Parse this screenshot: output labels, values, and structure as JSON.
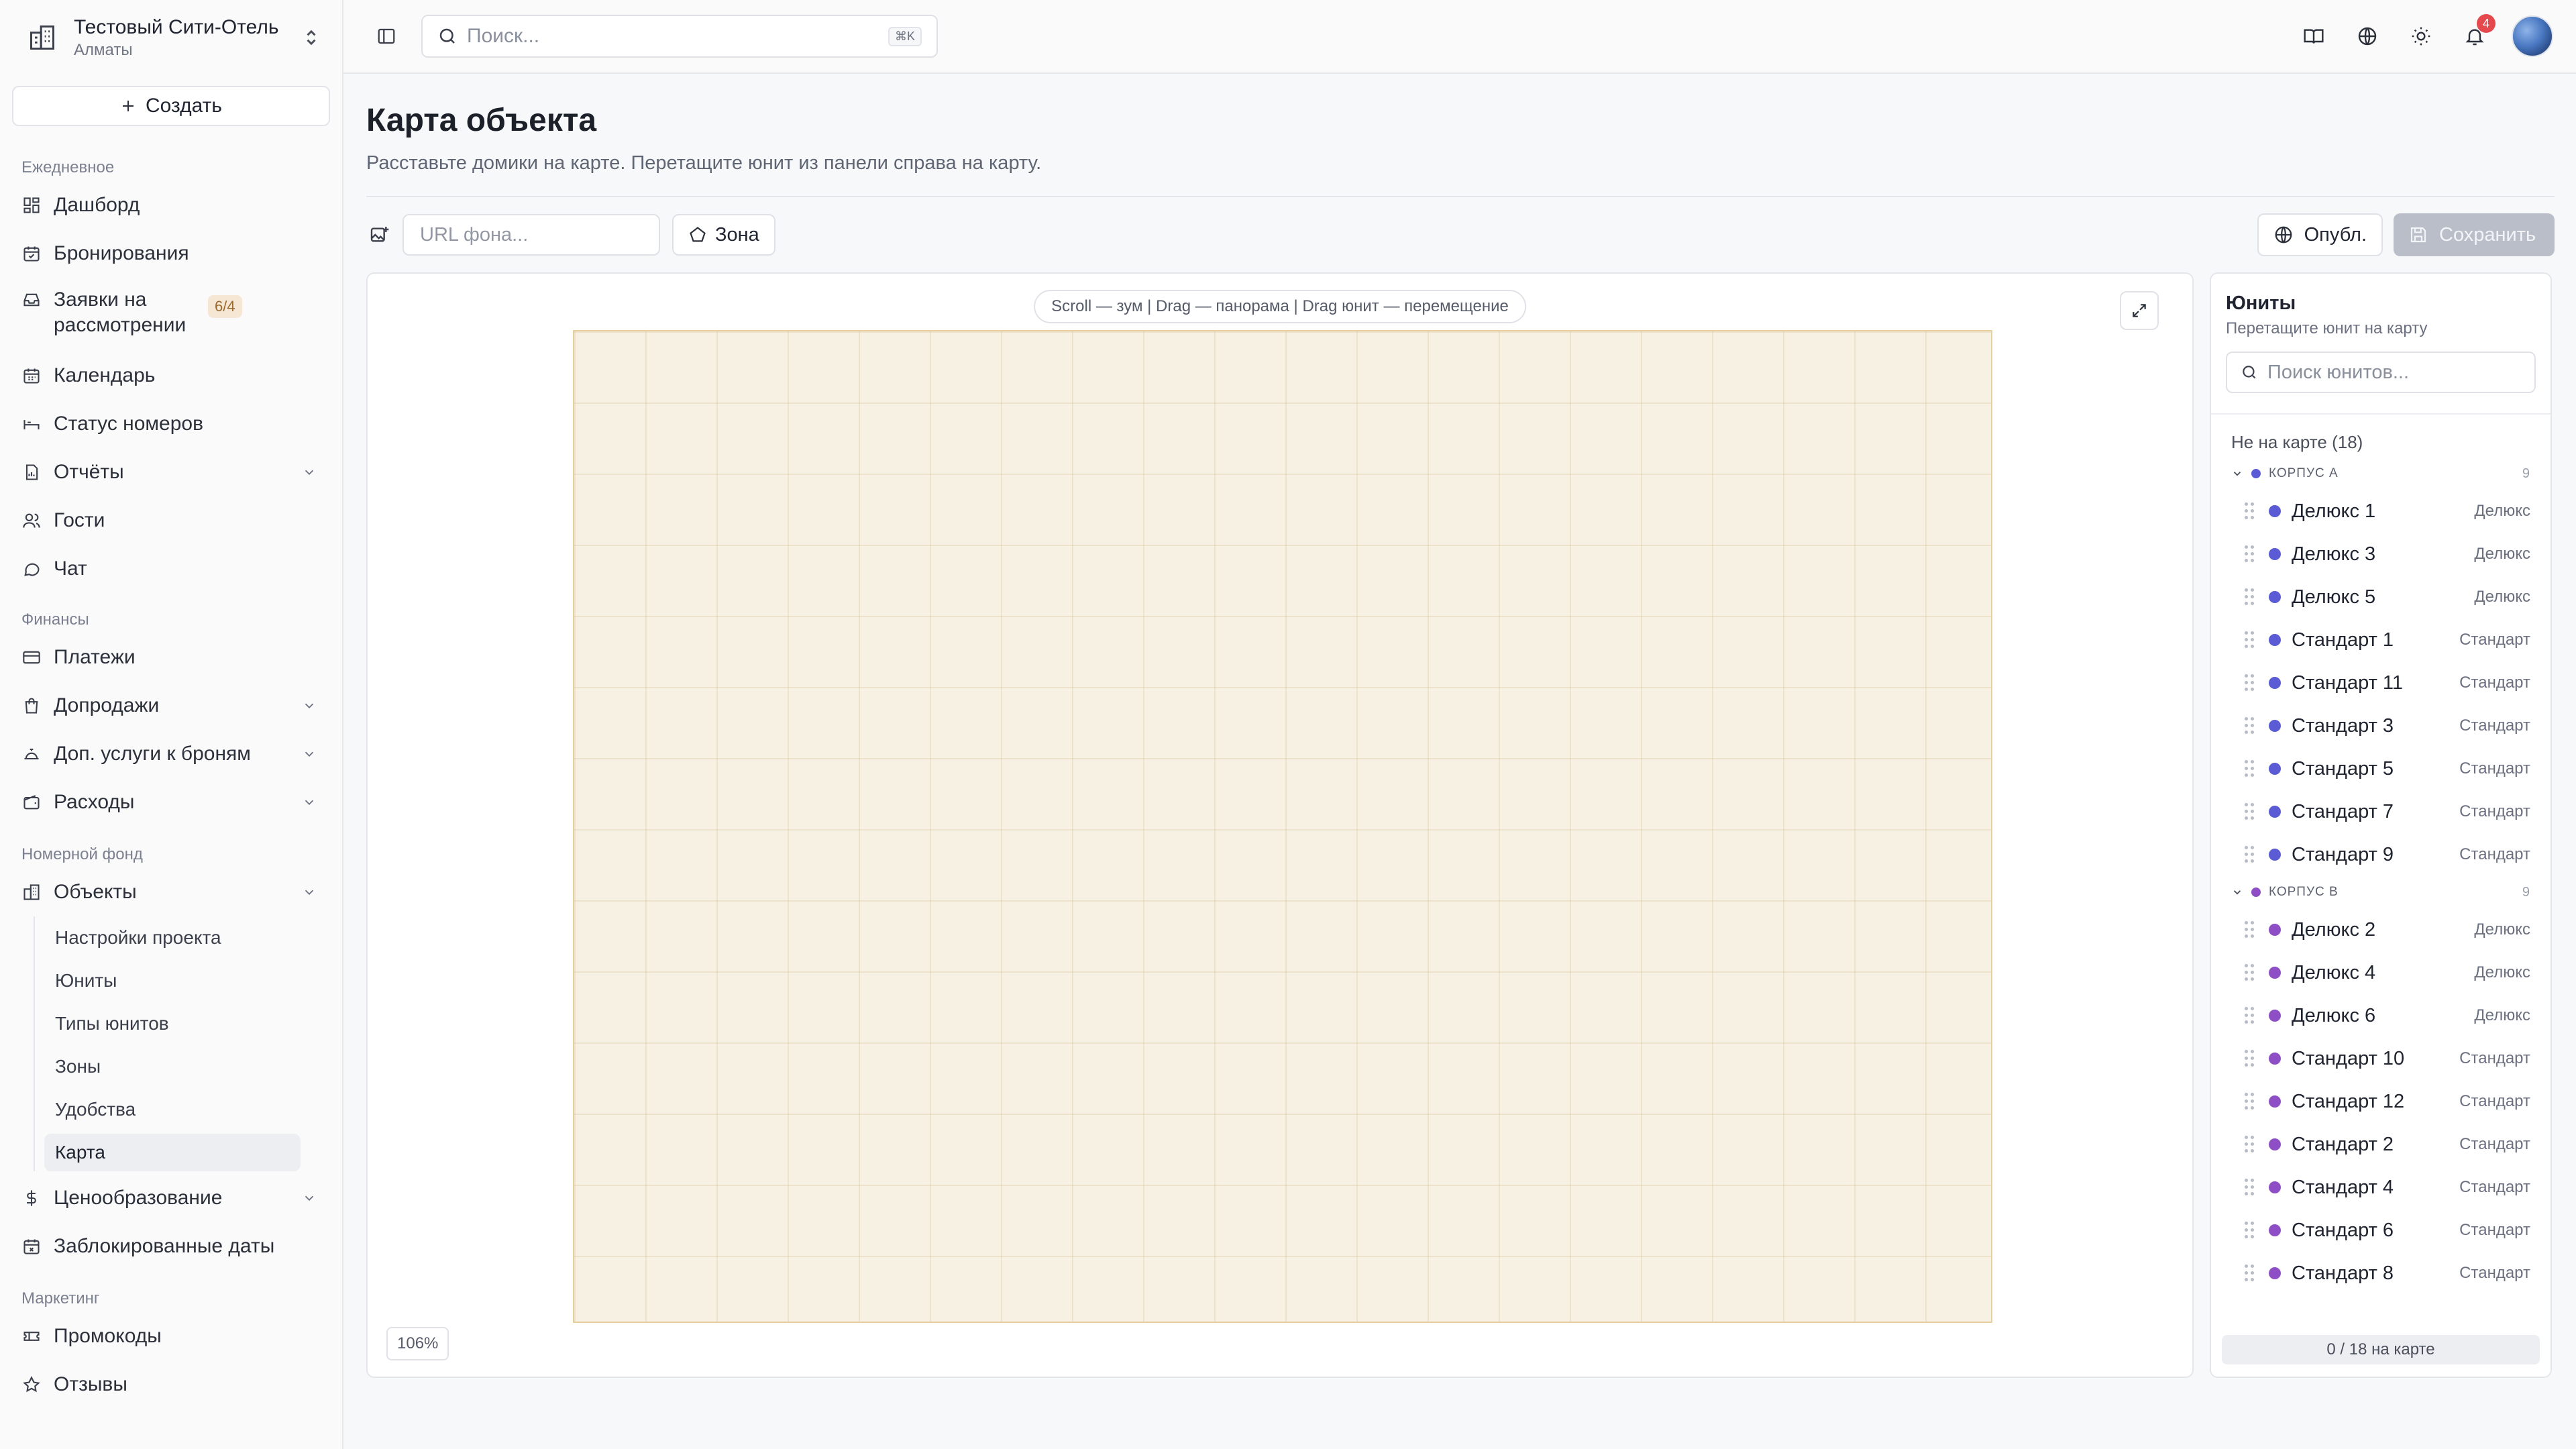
{
  "sidebar": {
    "hotel_name": "Тестовый Сити-Отель",
    "hotel_city": "Алматы",
    "create_label": "Создать",
    "sections": {
      "daily": "Ежедневное",
      "finance": "Финансы",
      "rooms": "Номерной фонд",
      "marketing": "Маркетинг"
    },
    "items": {
      "dashboard": "Дашборд",
      "bookings": "Бронирования",
      "requests": "Заявки на рассмотрении",
      "requests_badge": "6/4",
      "calendar": "Календарь",
      "room_status": "Статус номеров",
      "reports": "Отчёты",
      "guests": "Гости",
      "chat": "Чат",
      "payments": "Платежи",
      "upsells": "Допродажи",
      "extras": "Доп. услуги к броням",
      "expenses": "Расходы",
      "objects": "Объекты",
      "pricing": "Ценообразование",
      "blocked": "Заблокированные даты",
      "promocodes": "Промокоды",
      "reviews": "Отзывы"
    },
    "objects_sub": [
      "Настройки проекта",
      "Юниты",
      "Типы юнитов",
      "Зоны",
      "Удобства",
      "Карта"
    ]
  },
  "topbar": {
    "search_placeholder": "Поиск...",
    "shortcut": "⌘K",
    "notifications": "4"
  },
  "page": {
    "title": "Карта объекта",
    "subtitle": "Расставьте домики на карте. Перетащите юнит из панели справа на карту.",
    "url_placeholder": "URL фона...",
    "zone_label": "Зона",
    "publish_label": "Опубл.",
    "save_label": "Сохранить",
    "hint": "Scroll — зум | Drag — панорама | Drag юнит — перемещение",
    "zoom": "106%"
  },
  "units_panel": {
    "title": "Юниты",
    "subtitle": "Перетащите юнит на карту",
    "search_placeholder": "Поиск юнитов...",
    "not_on_map": "Не на карте (18)",
    "footer": "0 / 18 на карте",
    "groups": [
      {
        "name": "КОРПУС А",
        "count": "9",
        "color": "#5b5bd6",
        "units": [
          {
            "name": "Делюкс 1",
            "type": "Делюкс"
          },
          {
            "name": "Делюкс 3",
            "type": "Делюкс"
          },
          {
            "name": "Делюкс 5",
            "type": "Делюкс"
          },
          {
            "name": "Стандарт 1",
            "type": "Стандарт"
          },
          {
            "name": "Стандарт 11",
            "type": "Стандарт"
          },
          {
            "name": "Стандарт 3",
            "type": "Стандарт"
          },
          {
            "name": "Стандарт 5",
            "type": "Стандарт"
          },
          {
            "name": "Стандарт 7",
            "type": "Стандарт"
          },
          {
            "name": "Стандарт 9",
            "type": "Стандарт"
          }
        ]
      },
      {
        "name": "КОРПУС В",
        "count": "9",
        "color": "#8e4ec6",
        "units": [
          {
            "name": "Делюкс 2",
            "type": "Делюкс"
          },
          {
            "name": "Делюкс 4",
            "type": "Делюкс"
          },
          {
            "name": "Делюкс 6",
            "type": "Делюкс"
          },
          {
            "name": "Стандарт 10",
            "type": "Стандарт"
          },
          {
            "name": "Стандарт 12",
            "type": "Стандарт"
          },
          {
            "name": "Стандарт 2",
            "type": "Стандарт"
          },
          {
            "name": "Стандарт 4",
            "type": "Стандарт"
          },
          {
            "name": "Стандарт 6",
            "type": "Стандарт"
          },
          {
            "name": "Стандарт 8",
            "type": "Стандарт"
          }
        ]
      }
    ]
  }
}
